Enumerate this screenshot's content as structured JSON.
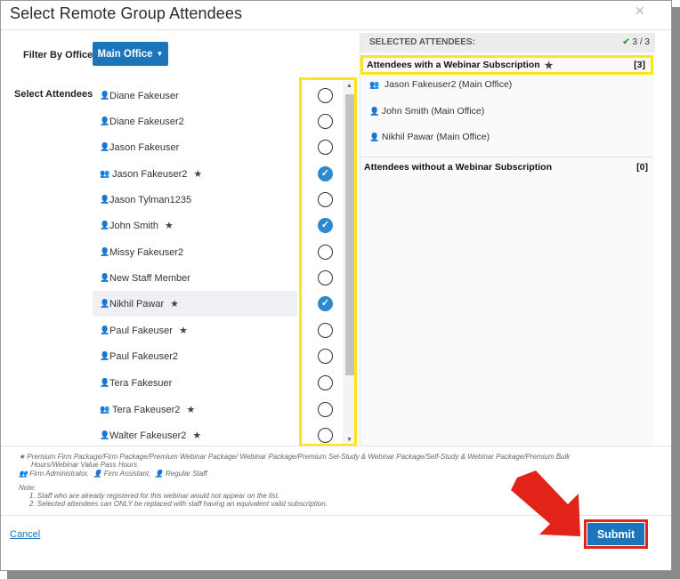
{
  "title": "Select Remote Group Attendees",
  "filter": {
    "label": "Filter By Office",
    "selected": "Main Office"
  },
  "select_label": "Select Attendees",
  "attendees": [
    {
      "name": "Diane Fakeuser",
      "role": "regular",
      "star": false,
      "checked": false
    },
    {
      "name": "Diane Fakeuser2",
      "role": "regular",
      "star": false,
      "checked": false
    },
    {
      "name": "Jason Fakeuser",
      "role": "regular",
      "star": false,
      "checked": false
    },
    {
      "name": "Jason Fakeuser2",
      "role": "admin",
      "star": true,
      "checked": true
    },
    {
      "name": "Jason Tylman1235",
      "role": "regular",
      "star": false,
      "checked": false
    },
    {
      "name": "John Smith",
      "role": "regular",
      "star": true,
      "checked": true
    },
    {
      "name": "Missy Fakeuser2",
      "role": "regular",
      "star": false,
      "checked": false
    },
    {
      "name": "New Staff Member",
      "role": "regular",
      "star": false,
      "checked": false
    },
    {
      "name": "Nikhil Pawar",
      "role": "regular",
      "star": true,
      "checked": true,
      "highlighted": true
    },
    {
      "name": "Paul Fakeuser",
      "role": "regular",
      "star": true,
      "checked": false
    },
    {
      "name": "Paul Fakeuser2",
      "role": "regular",
      "star": false,
      "checked": false
    },
    {
      "name": "Tera Fakesuer",
      "role": "regular",
      "star": false,
      "checked": false
    },
    {
      "name": "Tera Fakeuser2",
      "role": "admin",
      "star": true,
      "checked": false
    },
    {
      "name": "Walter Fakeuser2",
      "role": "regular",
      "star": true,
      "checked": false
    }
  ],
  "selected_panel": {
    "title": "SELECTED ATTENDEES:",
    "count": "3 / 3",
    "with_label": "Attendees with a Webinar Subscription",
    "with_count": "[3]",
    "with_list": [
      "Jason Fakeuser2 (Main Office)",
      "John Smith (Main Office)",
      "Nikhil Pawar (Main Office)"
    ],
    "without_label": "Attendees without a Webinar Subscription",
    "without_count": "[0]"
  },
  "legend": {
    "star_text": "Premium Firm Package/Firm Package/Premium Webinar Package/ Webinar Package/Premium Sel-Study & Webinar Package/Self-Study & Webinar Package/Premium Bulk",
    "star_text2": "Hours/Webinar Value Pass Hours",
    "admin": "Firm Administrator,",
    "assistant": "Firm Assistant,",
    "regular": "Regular Staff"
  },
  "note": {
    "title": "Note:",
    "line1": "1. Staff who are already registered for this webinar would not appear on the list.",
    "line2": "2. Selected attendees can ONLY be replaced with staff having an equivalent valid subscription."
  },
  "cancel_label": "Cancel",
  "submit_label": "Submit",
  "colors": {
    "primary": "#1a75bb",
    "highlight": "#ffe512",
    "annotation": "#e2231a",
    "check": "#2e8ad0"
  }
}
